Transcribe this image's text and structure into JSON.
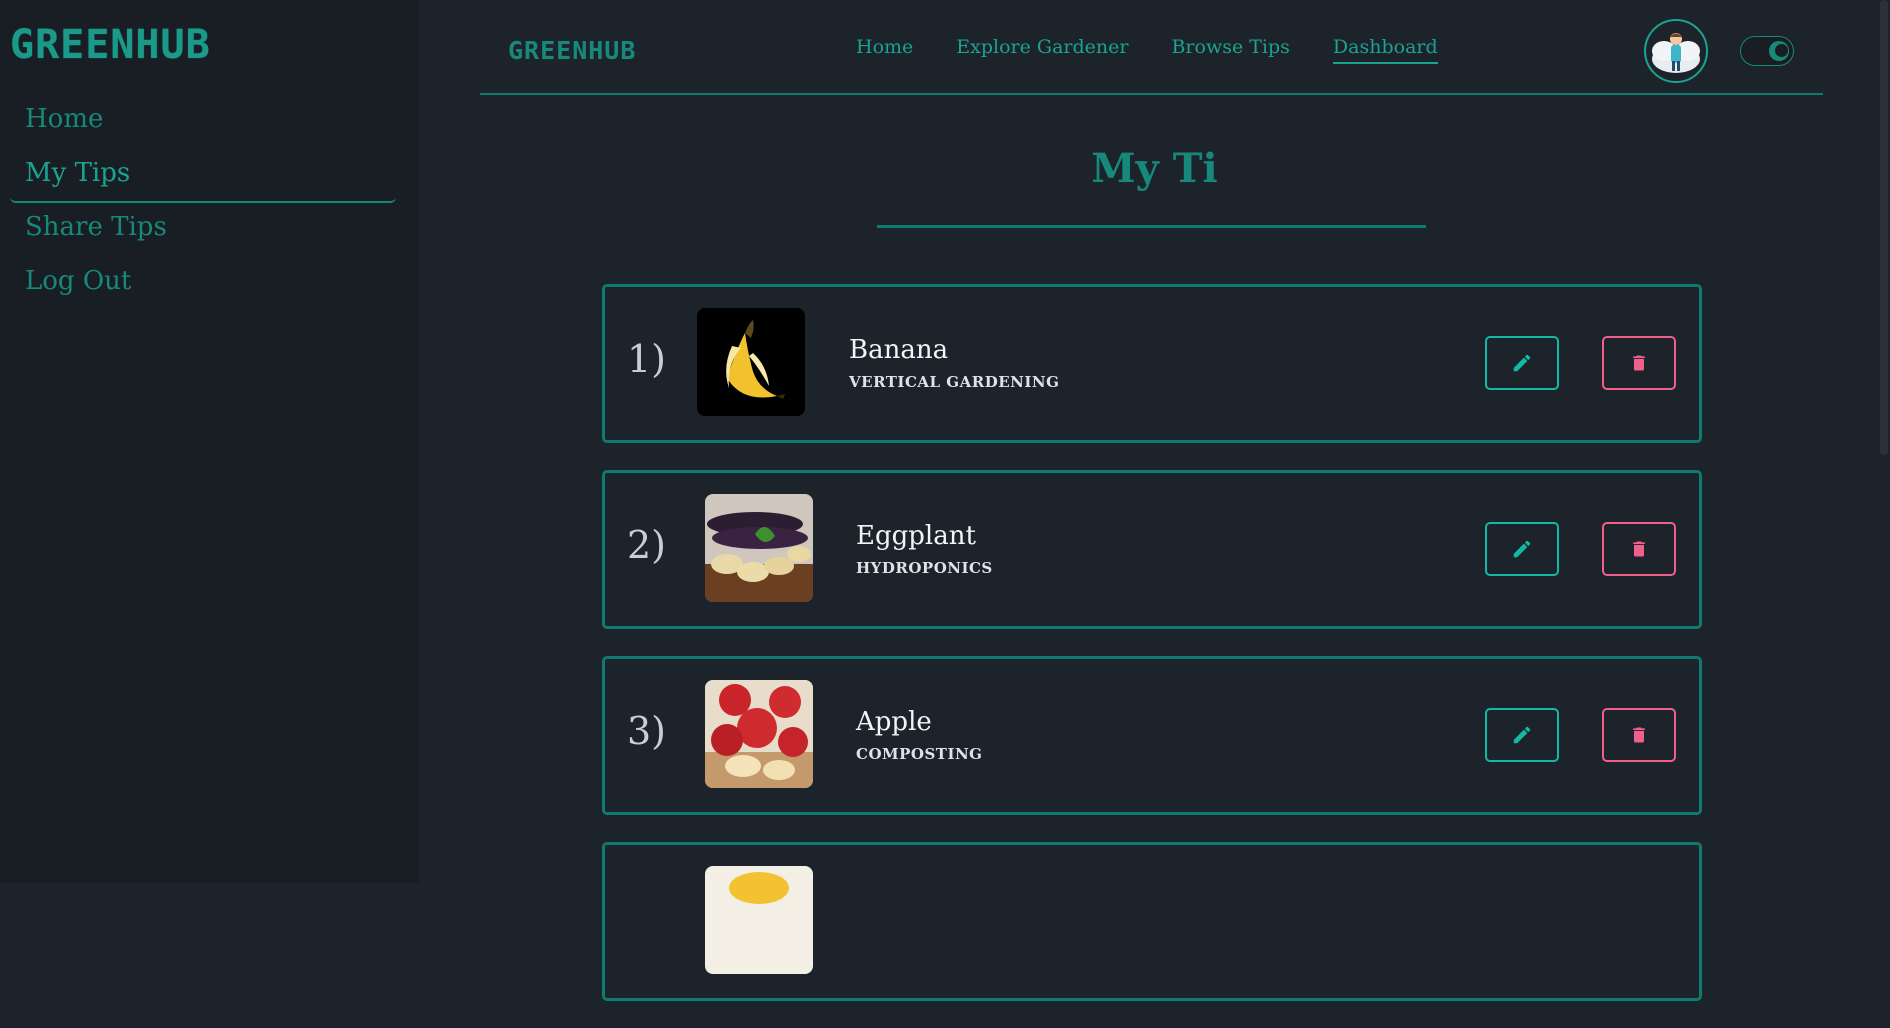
{
  "sidebar": {
    "logo": "GREENHUB",
    "items": [
      {
        "label": "Home"
      },
      {
        "label": "My Tips"
      },
      {
        "label": "Share Tips"
      },
      {
        "label": "Log Out"
      }
    ]
  },
  "navbar": {
    "logo": "GREENHUB",
    "links": [
      {
        "label": "Home"
      },
      {
        "label": "Explore Gardener"
      },
      {
        "label": "Browse Tips"
      },
      {
        "label": "Dashboard"
      }
    ]
  },
  "page": {
    "title": "My Ti"
  },
  "tips": [
    {
      "index": "1)",
      "name": "Banana",
      "category": "VERTICAL GARDENING"
    },
    {
      "index": "2)",
      "name": "Eggplant",
      "category": "HYDROPONICS"
    },
    {
      "index": "3)",
      "name": "Apple",
      "category": "COMPOSTING"
    }
  ],
  "colors": {
    "accent": "#1aa391",
    "border": "#0f7a6e",
    "edit": "#14b8a6",
    "delete": "#f0608a",
    "background": "#1d232a",
    "sidebar": "#191e24"
  },
  "icons": {
    "edit": "pencil-icon",
    "delete": "trash-icon",
    "theme": "moon-icon"
  }
}
